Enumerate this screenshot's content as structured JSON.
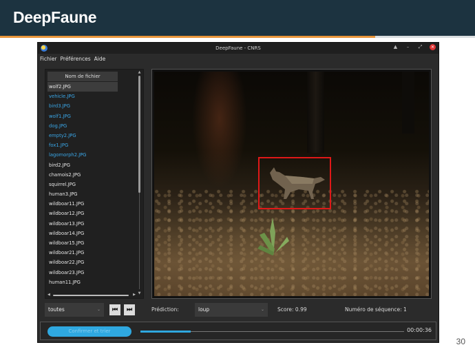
{
  "slide": {
    "brand": "DeepFaune",
    "page_number": "30",
    "accent_color": "#e8953a",
    "header_color": "#1c3340"
  },
  "window": {
    "title": "DeepFaune - CNRS",
    "controls": [
      "▲",
      "–",
      "⤢",
      "✕"
    ]
  },
  "menu": [
    "Fichier",
    "Préférences",
    "Aide"
  ],
  "filelist": {
    "header": "Nom de fichier",
    "items": [
      {
        "name": "wolf2.JPG",
        "state": "selected"
      },
      {
        "name": "vehicle.JPG",
        "state": "blue"
      },
      {
        "name": "bird3.JPG",
        "state": "blue"
      },
      {
        "name": "wolf1.JPG",
        "state": "blue"
      },
      {
        "name": "dog.JPG",
        "state": "blue"
      },
      {
        "name": "empty2.JPG",
        "state": "blue"
      },
      {
        "name": "fox1.JPG",
        "state": "blue"
      },
      {
        "name": "lagomorph2.JPG",
        "state": "blue"
      },
      {
        "name": "bird2.JPG",
        "state": "normal"
      },
      {
        "name": "chamois2.JPG",
        "state": "normal"
      },
      {
        "name": "squirrel.JPG",
        "state": "normal"
      },
      {
        "name": "human3.JPG",
        "state": "normal"
      },
      {
        "name": "wildboar11.JPG",
        "state": "normal"
      },
      {
        "name": "wildboar12.JPG",
        "state": "normal"
      },
      {
        "name": "wildboar13.JPG",
        "state": "normal"
      },
      {
        "name": "wildboar14.JPG",
        "state": "normal"
      },
      {
        "name": "wildboar15.JPG",
        "state": "normal"
      },
      {
        "name": "wildboar21.JPG",
        "state": "normal"
      },
      {
        "name": "wildboar22.JPG",
        "state": "normal"
      },
      {
        "name": "wildboar23.JPG",
        "state": "normal"
      },
      {
        "name": "human11.JPG",
        "state": "normal"
      }
    ]
  },
  "controls": {
    "filter_value": "toutes",
    "prev_icon": "skip-previous-icon",
    "next_icon": "skip-next-icon",
    "prediction_label": "Prédiction:",
    "prediction_value": "loup",
    "score": "Score: 0.99",
    "sequence": "Numéro de séquence: 1"
  },
  "progress": {
    "button_label": "Confirmer et trier",
    "fraction": 0.19,
    "time": "00:00:36",
    "accent": "#2fa8e0"
  }
}
